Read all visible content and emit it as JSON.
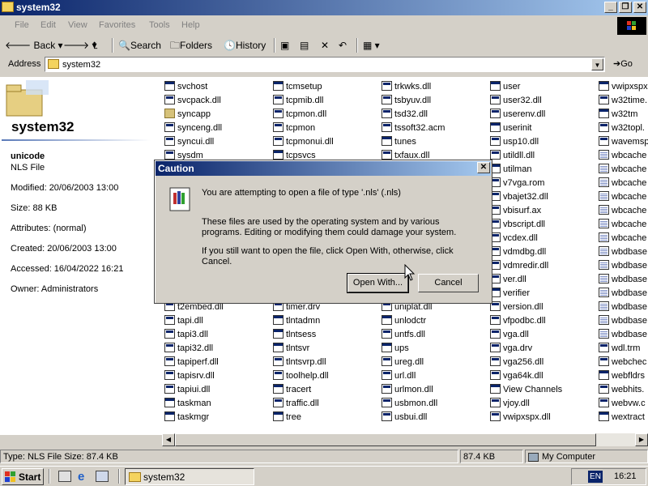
{
  "window": {
    "title": "system32"
  },
  "menu": [
    "File",
    "Edit",
    "View",
    "Favorites",
    "Tools",
    "Help"
  ],
  "toolbar": {
    "back": "Back",
    "search": "Search",
    "folders": "Folders",
    "history": "History"
  },
  "address": {
    "label": "Address",
    "value": "system32",
    "go": "Go"
  },
  "details": {
    "folder_name": "system32",
    "file_name": "unicode",
    "file_type": "NLS File",
    "modified": "Modified: 20/06/2003 13:00",
    "size": "Size: 88 KB",
    "attributes": "Attributes: (normal)",
    "created": "Created: 20/06/2003 13:00",
    "accessed": "Accessed: 16/04/2022 16:21",
    "owner": "Owner: Administrators"
  },
  "files": {
    "col1": [
      {
        "n": "svchost",
        "t": "app"
      },
      {
        "n": "svcpack.dll",
        "t": "cfg"
      },
      {
        "n": "syncapp",
        "t": "fold"
      },
      {
        "n": "synceng.dll",
        "t": "cfg"
      },
      {
        "n": "syncui.dll",
        "t": "cfg"
      },
      {
        "n": "sysdm",
        "t": "cfg"
      },
      {
        "n": "",
        "t": ""
      },
      {
        "n": "",
        "t": ""
      },
      {
        "n": "",
        "t": ""
      },
      {
        "n": "",
        "t": ""
      },
      {
        "n": "",
        "t": ""
      },
      {
        "n": "",
        "t": ""
      },
      {
        "n": "",
        "t": ""
      },
      {
        "n": "",
        "t": ""
      },
      {
        "n": "",
        "t": ""
      },
      {
        "n": "",
        "t": ""
      },
      {
        "n": "t2embed.dll",
        "t": "cfg"
      },
      {
        "n": "tapi.dll",
        "t": "cfg"
      },
      {
        "n": "tapi3.dll",
        "t": "cfg"
      },
      {
        "n": "tapi32.dll",
        "t": "cfg"
      },
      {
        "n": "tapiperf.dll",
        "t": "cfg"
      },
      {
        "n": "tapisrv.dll",
        "t": "cfg"
      },
      {
        "n": "tapiui.dll",
        "t": "cfg"
      },
      {
        "n": "taskman",
        "t": "app"
      },
      {
        "n": "taskmgr",
        "t": "app"
      }
    ],
    "col2": [
      {
        "n": "tcmsetup",
        "t": "app"
      },
      {
        "n": "tcpmib.dll",
        "t": "cfg"
      },
      {
        "n": "tcpmon.dll",
        "t": "cfg"
      },
      {
        "n": "tcpmon",
        "t": "cfg"
      },
      {
        "n": "tcpmonui.dll",
        "t": "cfg"
      },
      {
        "n": "tcpsvcs",
        "t": "app"
      },
      {
        "n": "",
        "t": ""
      },
      {
        "n": "",
        "t": ""
      },
      {
        "n": "",
        "t": ""
      },
      {
        "n": "",
        "t": ""
      },
      {
        "n": "",
        "t": ""
      },
      {
        "n": "",
        "t": ""
      },
      {
        "n": "",
        "t": ""
      },
      {
        "n": "",
        "t": ""
      },
      {
        "n": "",
        "t": ""
      },
      {
        "n": "",
        "t": ""
      },
      {
        "n": "timer.drv",
        "t": "cfg"
      },
      {
        "n": "tlntadmn",
        "t": "app"
      },
      {
        "n": "tlntsess",
        "t": "app"
      },
      {
        "n": "tlntsvr",
        "t": "app"
      },
      {
        "n": "tlntsvrp.dll",
        "t": "cfg"
      },
      {
        "n": "toolhelp.dll",
        "t": "cfg"
      },
      {
        "n": "tracert",
        "t": "app"
      },
      {
        "n": "traffic.dll",
        "t": "cfg"
      },
      {
        "n": "tree",
        "t": "app"
      }
    ],
    "col3": [
      {
        "n": "trkwks.dll",
        "t": "cfg"
      },
      {
        "n": "tsbyuv.dll",
        "t": "cfg"
      },
      {
        "n": "tsd32.dll",
        "t": "cfg"
      },
      {
        "n": "tssoft32.acm",
        "t": "cfg"
      },
      {
        "n": "tunes",
        "t": "app"
      },
      {
        "n": "txfaux.dll",
        "t": "cfg"
      },
      {
        "n": "",
        "t": ""
      },
      {
        "n": "",
        "t": ""
      },
      {
        "n": "",
        "t": ""
      },
      {
        "n": "",
        "t": ""
      },
      {
        "n": "",
        "t": ""
      },
      {
        "n": "",
        "t": ""
      },
      {
        "n": "",
        "t": ""
      },
      {
        "n": "",
        "t": ""
      },
      {
        "n": "",
        "t": ""
      },
      {
        "n": "",
        "t": ""
      },
      {
        "n": "uniplat.dll",
        "t": "cfg"
      },
      {
        "n": "unlodctr",
        "t": "app"
      },
      {
        "n": "untfs.dll",
        "t": "cfg"
      },
      {
        "n": "ups",
        "t": "app"
      },
      {
        "n": "ureg.dll",
        "t": "cfg"
      },
      {
        "n": "url.dll",
        "t": "cfg"
      },
      {
        "n": "urlmon.dll",
        "t": "cfg"
      },
      {
        "n": "usbmon.dll",
        "t": "cfg"
      },
      {
        "n": "usbui.dll",
        "t": "cfg"
      }
    ],
    "col4": [
      {
        "n": "user",
        "t": "app"
      },
      {
        "n": "user32.dll",
        "t": "cfg"
      },
      {
        "n": "userenv.dll",
        "t": "cfg"
      },
      {
        "n": "userinit",
        "t": "app"
      },
      {
        "n": "usp10.dll",
        "t": "cfg"
      },
      {
        "n": "utildll.dll",
        "t": "cfg"
      },
      {
        "n": "utilman",
        "t": "app"
      },
      {
        "n": "v7vga.rom",
        "t": "cfg"
      },
      {
        "n": "vbajet32.dll",
        "t": "cfg"
      },
      {
        "n": "vbisurf.ax",
        "t": "cfg"
      },
      {
        "n": "vbscript.dll",
        "t": "cfg"
      },
      {
        "n": "vcdex.dll",
        "t": "cfg"
      },
      {
        "n": "vdmdbg.dll",
        "t": "cfg"
      },
      {
        "n": "vdmredir.dll",
        "t": "cfg"
      },
      {
        "n": "ver.dll",
        "t": "cfg"
      },
      {
        "n": "verifier",
        "t": "app"
      },
      {
        "n": "version.dll",
        "t": "cfg"
      },
      {
        "n": "vfpodbc.dll",
        "t": "cfg"
      },
      {
        "n": "vga.dll",
        "t": "cfg"
      },
      {
        "n": "vga.drv",
        "t": "cfg"
      },
      {
        "n": "vga256.dll",
        "t": "cfg"
      },
      {
        "n": "vga64k.dll",
        "t": "cfg"
      },
      {
        "n": "View Channels",
        "t": "app"
      },
      {
        "n": "vjoy.dll",
        "t": "cfg"
      },
      {
        "n": "vwipxspx.dll",
        "t": "cfg"
      }
    ],
    "col5": [
      {
        "n": "vwipxspx",
        "t": "app"
      },
      {
        "n": "w32time.",
        "t": "cfg"
      },
      {
        "n": "w32tm",
        "t": "app"
      },
      {
        "n": "w32topl.",
        "t": "cfg"
      },
      {
        "n": "wavemsp",
        "t": "cfg"
      },
      {
        "n": "wbcache",
        "t": "nls"
      },
      {
        "n": "wbcache",
        "t": "nls"
      },
      {
        "n": "wbcache",
        "t": "nls"
      },
      {
        "n": "wbcache",
        "t": "nls"
      },
      {
        "n": "wbcache",
        "t": "nls"
      },
      {
        "n": "wbcache",
        "t": "nls"
      },
      {
        "n": "wbcache",
        "t": "nls"
      },
      {
        "n": "wbdbase",
        "t": "nls"
      },
      {
        "n": "wbdbase",
        "t": "nls"
      },
      {
        "n": "wbdbase",
        "t": "nls"
      },
      {
        "n": "wbdbase",
        "t": "nls"
      },
      {
        "n": "wbdbase",
        "t": "nls"
      },
      {
        "n": "wbdbase",
        "t": "nls"
      },
      {
        "n": "wbdbase",
        "t": "nls"
      },
      {
        "n": "wdl.trm",
        "t": "cfg"
      },
      {
        "n": "webchec",
        "t": "cfg"
      },
      {
        "n": "webfldrs",
        "t": "app"
      },
      {
        "n": "webhits.",
        "t": "cfg"
      },
      {
        "n": "webvw.c",
        "t": "cfg"
      },
      {
        "n": "wextract",
        "t": "app"
      }
    ]
  },
  "dialog": {
    "title": "Caution",
    "line1": "You are attempting to open a file of type '.nls' (.nls)",
    "line2": "These files are used by the operating system and by various programs. Editing or modifying them could damage your system.",
    "line3": "If you still want to open the file, click Open With, otherwise, click Cancel.",
    "open_with": "Open With...",
    "cancel": "Cancel"
  },
  "status": {
    "type": "Type: NLS File Size: 87.4 KB",
    "size": "87.4 KB",
    "zone": "My Computer"
  },
  "taskbar": {
    "start": "Start",
    "task": "system32",
    "lang": "EN",
    "time": "16:21"
  }
}
